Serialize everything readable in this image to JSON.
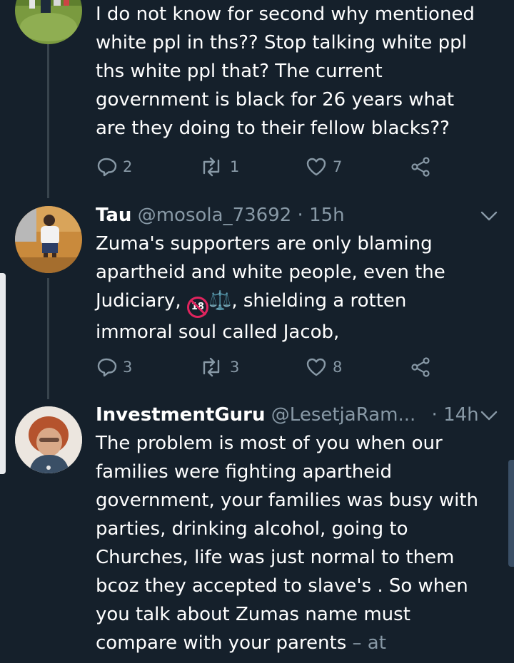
{
  "tweets": [
    {
      "text_lines": [
        "I do not know for second why mentioned",
        "white ppl in ths?? Stop talking white ppl",
        "ths white ppl that? The current",
        "government is black for 26 years what",
        "are they doing to their fellow blacks??"
      ],
      "replies": "2",
      "retweets": "1",
      "likes": "7"
    },
    {
      "name": "Tau",
      "handle": "@mosola_73692",
      "separator": "·",
      "time": "15h",
      "text_lines": [
        "Zuma's supporters are only blaming",
        "apartheid and white people, even the",
        "Judiciary, ",
        ", shielding a rotten",
        "immoral soul called Jacob,"
      ],
      "emoji_18": "18",
      "emoji_scales": "⚖️",
      "replies": "3",
      "retweets": "3",
      "likes": "8"
    },
    {
      "name": "InvestmentGuru",
      "handle": "@LesetjaRam...",
      "separator": "·",
      "time": "14h",
      "text_lines": [
        "The problem is most of you when our",
        "families were fighting apartheid",
        "government, your families was busy with",
        "parties, drinking alcohol, going to",
        "Churches, life was just normal to them",
        "bcoz they accepted to slave's . So when",
        "you talk about Zumas name must",
        "compare with your parents"
      ],
      "truncation": " – at"
    }
  ],
  "icons": {
    "reply": "reply-icon",
    "retweet": "retweet-icon",
    "like": "heart-icon",
    "share": "share-icon",
    "menu": "chevron-down-icon"
  },
  "colors": {
    "background": "#15202b",
    "text": "#ffffff",
    "muted": "#8899a6",
    "thread_line": "#38444d"
  }
}
